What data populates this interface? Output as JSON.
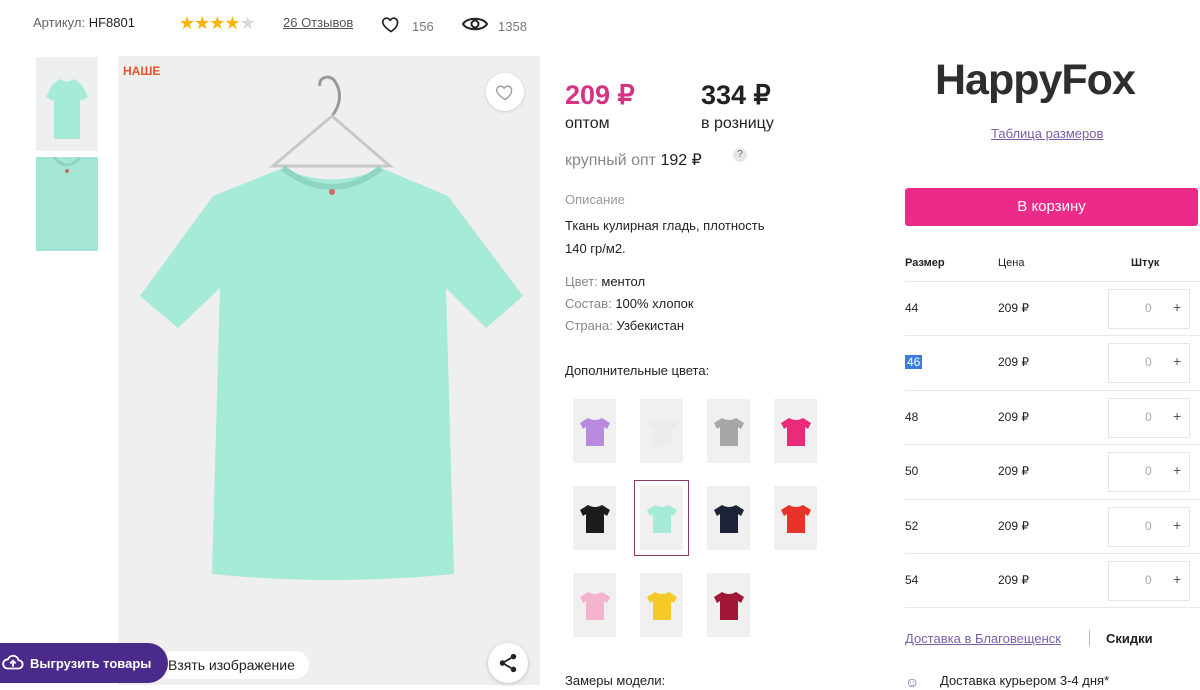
{
  "header": {
    "sku_label": "Артикул:",
    "sku_value": "HF8801",
    "rating": 4,
    "rating_max": 5,
    "reviews": "26 Отзывов",
    "favorites_count": "156",
    "views_count": "1358"
  },
  "gallery": {
    "badge": "НАШЕ",
    "take_image": "Взять изображение",
    "export_button": "Выгрузить товары"
  },
  "prices": {
    "wholesale": "209 ₽",
    "wholesale_label": "оптом",
    "retail": "334 ₽",
    "retail_label": "в розницу",
    "bulk_label": "крупный опт",
    "bulk_value": "192 ₽",
    "help": "?"
  },
  "description": {
    "heading": "Описание",
    "text": "Ткань кулирная гладь, плотность 140 гр/м2.",
    "color_key": "Цвет:",
    "color_val": "ментол",
    "composition_key": "Состав:",
    "composition_val": "100% хлопок",
    "country_key": "Страна:",
    "country_val": "Узбекистан",
    "more_colors": "Дополнительные цвета:",
    "model_measures": "Замеры модели:"
  },
  "colors": [
    {
      "hex": "#b98be0"
    },
    {
      "hex": "#ececec"
    },
    {
      "hex": "#a7a7a7"
    },
    {
      "hex": "#ec2a7a"
    },
    {
      "hex": "#1c1c1c"
    },
    {
      "hex": "#a6ead8",
      "selected": true
    },
    {
      "hex": "#1d2336"
    },
    {
      "hex": "#e7322a"
    },
    {
      "hex": "#f6b3cf"
    },
    {
      "hex": "#f5c928"
    },
    {
      "hex": "#a01836"
    }
  ],
  "panel": {
    "brand": "HappyFox",
    "size_chart": "Таблица размеров",
    "cart": "В корзину",
    "col_size": "Размер",
    "col_price": "Цена",
    "col_qty": "Штук",
    "rows": [
      {
        "size": "44",
        "price": "209 ₽",
        "qty": "0"
      },
      {
        "size": "46",
        "price": "209 ₽",
        "qty": "0"
      },
      {
        "size": "48",
        "price": "209 ₽",
        "qty": "0"
      },
      {
        "size": "50",
        "price": "209 ₽",
        "qty": "0"
      },
      {
        "size": "52",
        "price": "209 ₽",
        "qty": "0"
      },
      {
        "size": "54",
        "price": "209 ₽",
        "qty": "0"
      }
    ],
    "delivery": "Доставка в Благовещенск",
    "discounts": "Скидки",
    "courier": "Доставка курьером 3-4 дня*"
  },
  "theme": {
    "accent": "#ec2a8a",
    "price_color": "#d63384",
    "product_color": "#a6ead8"
  }
}
